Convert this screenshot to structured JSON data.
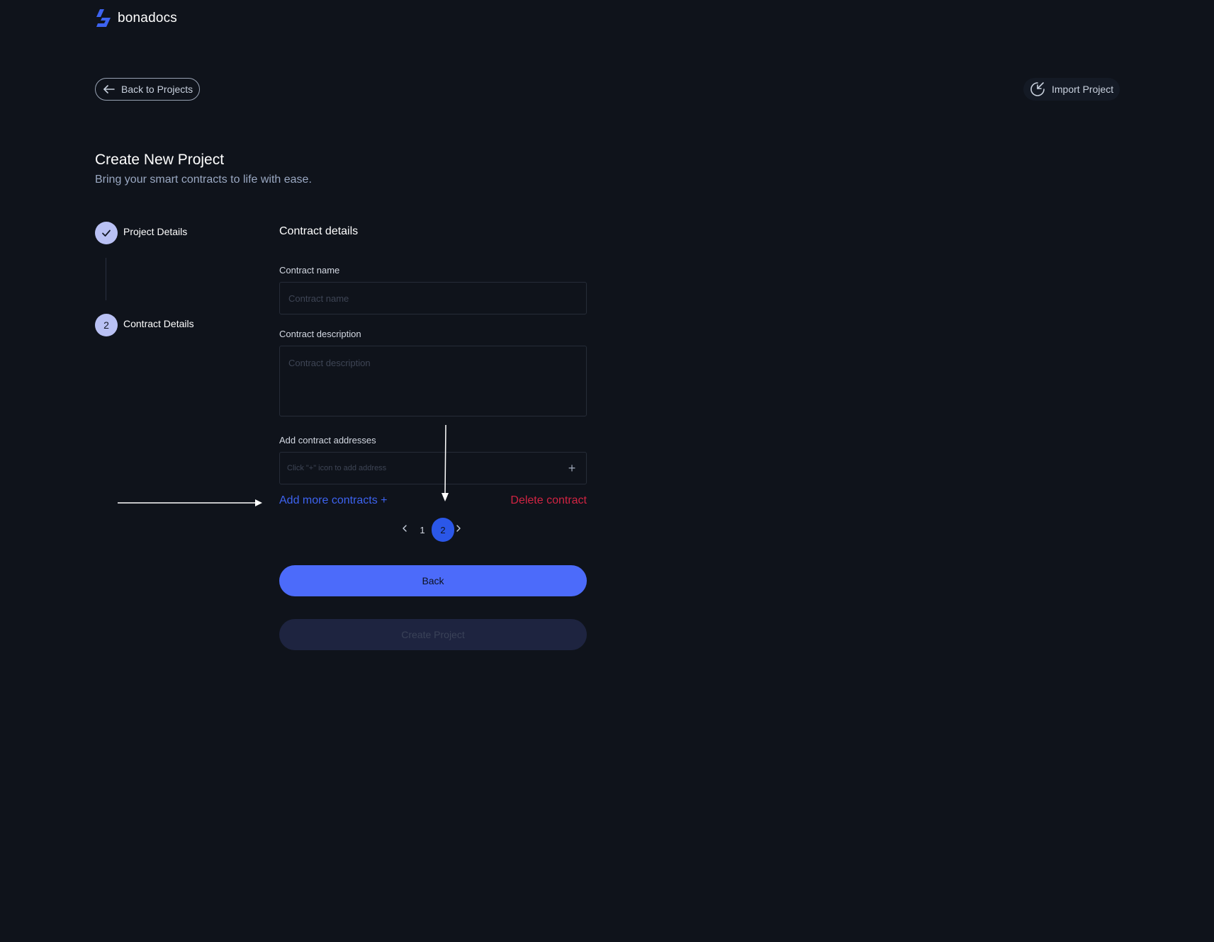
{
  "brand": {
    "name": "bonadocs",
    "logo_icon": "bonadocs-logo-icon",
    "accent": "#3d63f0"
  },
  "header": {
    "back_label": "Back to Projects",
    "back_icon": "arrow-left-icon",
    "import_label": "Import Project",
    "import_icon": "import-arrow-icon"
  },
  "page": {
    "title": "Create New Project",
    "subtitle": "Bring your smart contracts to life with ease."
  },
  "stepper": {
    "steps": [
      {
        "label": "Project Details",
        "status": "completed",
        "icon": "check-icon"
      },
      {
        "label": "Contract Details",
        "number": "2",
        "status": "active"
      }
    ]
  },
  "form": {
    "section_title": "Contract details",
    "name_label": "Contract name",
    "name_placeholder": "Contract name",
    "name_value": "",
    "desc_label": "Contract description",
    "desc_placeholder": "Contract description",
    "desc_value": "",
    "addr_label": "Add contract addresses",
    "addr_placeholder": "Click \"+\" icon to add address",
    "addr_plus": "+",
    "add_more_label": "Add more contracts +",
    "delete_label": "Delete contract"
  },
  "pagination": {
    "pages": [
      "1",
      "2"
    ],
    "current": "2",
    "prev_icon": "chevron-left-icon",
    "next_icon": "chevron-right-icon"
  },
  "actions": {
    "back_label": "Back",
    "create_label": "Create Project",
    "create_disabled": true
  },
  "colors": {
    "background": "#0f131b",
    "primary": "#4c6bfa",
    "danger": "#d22443",
    "link": "#3d63f0"
  }
}
